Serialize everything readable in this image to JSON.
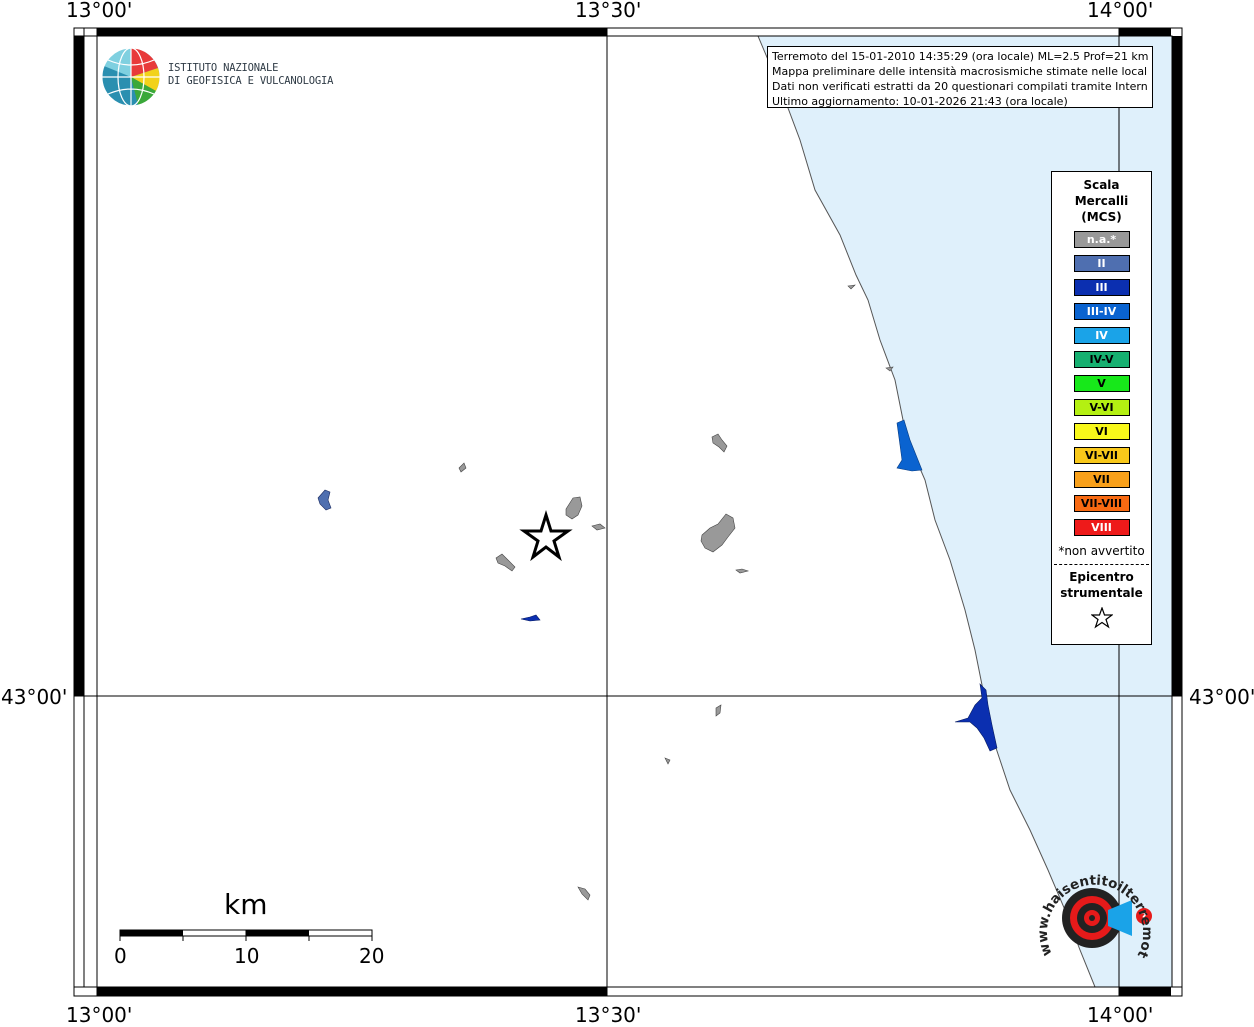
{
  "coordinates": {
    "top_left": "13°00'",
    "top_mid": "13°30'",
    "top_right": "14°00'",
    "left_mid": "43°00'",
    "right_mid": "43°00'",
    "bottom_left": "13°00'",
    "bottom_mid": "13°30'",
    "bottom_right": "14°00'"
  },
  "institute_logo": {
    "line1": "ISTITUTO NAZIONALE",
    "line2": "DI GEOFISICA E VULCANOLOGIA"
  },
  "info_box": {
    "line1": "Terremoto del 15-01-2010 14:35:29 (ora locale) ML=2.5 Prof=21 km",
    "line2": "Mappa preliminare delle intensità macrosismiche stimate nelle località",
    "line3": "Dati non verificati estratti da 20 questionari compilati tramite Internet.",
    "line4": "Ultimo aggiornamento: 10-01-2026 21:43 (ora locale)"
  },
  "legend": {
    "title_line1": "Scala",
    "title_line2": "Mercalli",
    "title_line3": "(MCS)",
    "items": [
      {
        "label": "n.a.*",
        "color": "#999999",
        "text_color": "#ffffff"
      },
      {
        "label": "II",
        "color": "#4f6fb0",
        "text_color": "#ffffff"
      },
      {
        "label": "III",
        "color": "#0b2fb0",
        "text_color": "#ffffff"
      },
      {
        "label": "III-IV",
        "color": "#0a63d0",
        "text_color": "#ffffff"
      },
      {
        "label": "IV",
        "color": "#1aa3e8",
        "text_color": "#ffffff"
      },
      {
        "label": "IV-V",
        "color": "#16b070",
        "text_color": "#000000"
      },
      {
        "label": "V",
        "color": "#17e81a",
        "text_color": "#000000"
      },
      {
        "label": "V-VI",
        "color": "#b4f012",
        "text_color": "#000000"
      },
      {
        "label": "VI",
        "color": "#f8f81a",
        "text_color": "#000000"
      },
      {
        "label": "VI-VII",
        "color": "#f8c81a",
        "text_color": "#000000"
      },
      {
        "label": "VII",
        "color": "#f8a01a",
        "text_color": "#000000"
      },
      {
        "label": "VII-VIII",
        "color": "#f86a12",
        "text_color": "#000000"
      },
      {
        "label": "VIII",
        "color": "#ee1a1a",
        "text_color": "#ffffff"
      }
    ],
    "note": "*non avvertito",
    "epicenter_line1": "Epicentro",
    "epicenter_line2": "strumentale"
  },
  "scale_bar": {
    "unit": "km",
    "label_0": "0",
    "label_10": "10",
    "label_20": "20"
  },
  "hsit_logo": {
    "text": "www.haisentitoilterremoto.it"
  },
  "colors": {
    "sea": "#dff0fb",
    "frame": "#000000"
  }
}
